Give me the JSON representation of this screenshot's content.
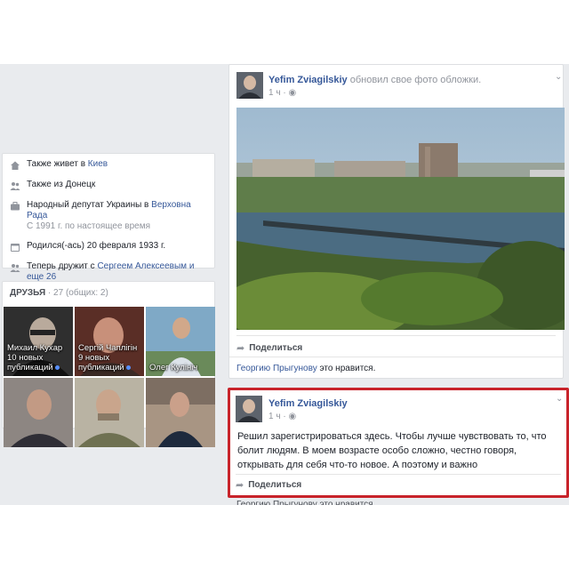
{
  "about": {
    "items": [
      {
        "icon": "home-icon",
        "text": "Также живет в ",
        "link": "Киев"
      },
      {
        "icon": "people-icon",
        "text": "Также из Донецк",
        "link": ""
      },
      {
        "icon": "briefcase-icon",
        "text": "Народный депутат Украины в ",
        "link": "Верховна Рада",
        "sub": "С 1991 г. по настоящее время"
      },
      {
        "icon": "calendar-icon",
        "text": "Родился(-ась) 20 февраля 1933 г.",
        "link": ""
      },
      {
        "icon": "people-icon",
        "text": "Теперь дружит с ",
        "link": "Сергеем Алексеевым и еще 26"
      }
    ]
  },
  "friends": {
    "title": "ДРУЗЬЯ",
    "count": " · 27 (общих: 2)",
    "tiles": [
      {
        "name": "Михаил Кухар",
        "sub": "10 новых публикаций",
        "bg": "#3b3b3b"
      },
      {
        "name": "Сергій Чаплігін",
        "sub": "9 новых публикаций",
        "bg": "#6d3a2e"
      },
      {
        "name": "Олег Кулініч",
        "sub": "",
        "bg": "#6f9ab8"
      },
      {
        "name": "",
        "sub": "",
        "bg": "#8a7f78"
      },
      {
        "name": "",
        "sub": "",
        "bg": "#7a7a62"
      },
      {
        "name": "",
        "sub": "",
        "bg": "#9f8f7c"
      }
    ]
  },
  "post1": {
    "author": "Yefim Zviagilskiy",
    "action": " обновил свое фото обложки.",
    "time": "1 ч",
    "share": "Поделиться",
    "likes_name": "Георгию Прыгунову",
    "likes_text": " это нравится."
  },
  "post2": {
    "author": "Yefim Zviagilskiy",
    "time": "1 ч",
    "text": "Решил зарегистрироваться здесь. Чтобы лучше чувствовать то, что болит людям. В моем возрасте особо сложно, честно говоря, открывать для себя что-то новое. А поэтому и важно",
    "share": "Поделиться"
  },
  "cut_likes": "Георгию Прыгунову это нравится.",
  "colors": {
    "link": "#365899",
    "highlight_border": "#c8232a",
    "feed_bg": "#e9ebee"
  }
}
